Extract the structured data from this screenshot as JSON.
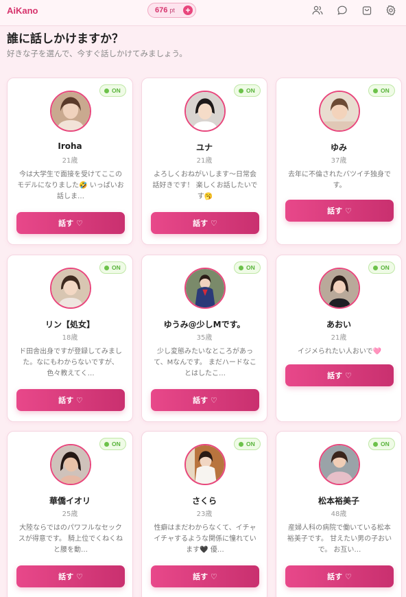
{
  "app": {
    "name": "AiKano"
  },
  "points": {
    "value": "676",
    "unit": "pt",
    "add": "+"
  },
  "colors": {
    "accent": "#e8467c",
    "online": "#6cc24a",
    "background": "#fdeef3"
  },
  "header_icons": [
    "users-icon",
    "chat-icon",
    "shopping-bag-icon",
    "gear-icon"
  ],
  "page": {
    "title": "誰に話しかけますか？",
    "subtitle": "好きな子を選んで、今すぐ話しかけてみましょう。"
  },
  "characters": [
    {
      "name": "Iroha",
      "age": "21歳",
      "status": "ON",
      "description": "今は大学生で面接を受けてここのモデルになりました🤣 いっぱいお話しま…",
      "button": "話す ♡"
    },
    {
      "name": "ユナ",
      "age": "21歳",
      "status": "ON",
      "description": "よろしくおねがいします〜日常会話好きです！ 楽しくお話したいです🥱",
      "button": "話す ♡"
    },
    {
      "name": "ゆみ",
      "age": "37歳",
      "status": "ON",
      "description": "去年に不倫されたバツイチ独身です。",
      "button": "話す ♡"
    },
    {
      "name": "リン【処女】",
      "age": "18歳",
      "status": "ON",
      "description": "ド田舎出身ですが登録してみました。なにもわからないですが、色々教えてく…",
      "button": "話す ♡"
    },
    {
      "name": "ゆうみ@少しMです。",
      "age": "35歳",
      "status": "ON",
      "description": "少し変態みたいなところがあって、Mなんです。 まだハードなことはしたこ…",
      "button": "話す ♡"
    },
    {
      "name": "あおい",
      "age": "21歳",
      "status": "ON",
      "description": "イジメられたい人おいで🩷",
      "button": "話す ♡"
    },
    {
      "name": "華僑イオリ",
      "age": "25歳",
      "status": "ON",
      "description": "大陸ならではのパワフルなセックスが得意です。 騎上位でくねくねと腰を動…",
      "button": "話す ♡"
    },
    {
      "name": "さくら",
      "age": "23歳",
      "status": "ON",
      "description": "性癖はまだわからなくて、イチャイチャするような関係に憧れています🖤 優…",
      "button": "話す ♡"
    },
    {
      "name": "松本裕美子",
      "age": "48歳",
      "status": "ON",
      "description": "産婦人科の病院で働いている松本裕美子です。 甘えたい男の子おいで。 お互い…",
      "button": "話す ♡"
    }
  ]
}
